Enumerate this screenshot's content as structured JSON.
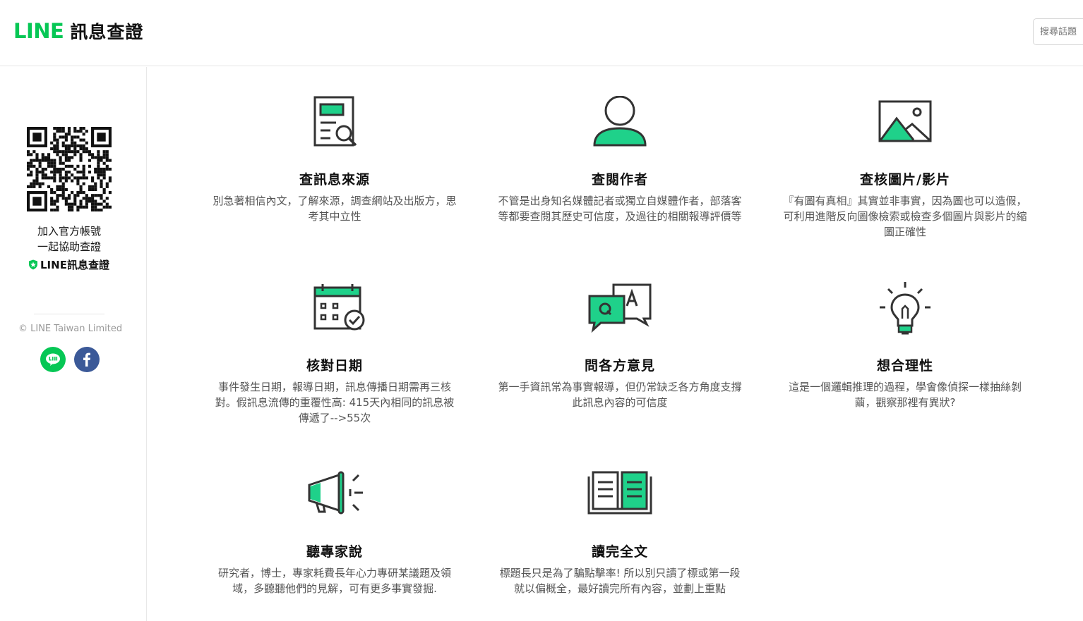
{
  "header": {
    "logo_brand": "LINE",
    "logo_name": "訊息查證",
    "search_placeholder": "搜尋話題"
  },
  "sidebar": {
    "join_line1": "加入官方帳號",
    "join_line2": "一起協助查證",
    "brand_label": "LINE訊息查證",
    "copyright": "© LINE Taiwan Limited",
    "social": [
      "line-icon",
      "facebook-icon"
    ]
  },
  "colors": {
    "accent": "#06c755",
    "icon_green": "#1fd18a",
    "facebook": "#3b5998",
    "text": "#111111"
  },
  "cards": [
    {
      "icon": "document-search-icon",
      "title": "查訊息來源",
      "desc": "別急著相信內文，了解來源，調查網站及出版方，思考其中立性"
    },
    {
      "icon": "person-icon",
      "title": "查閱作者",
      "desc": "不管是出身知名媒體記者或獨立自媒體作者，部落客等都要查閱其歷史可信度，及過往的相關報導評價等"
    },
    {
      "icon": "image-icon",
      "title": "查核圖片/影片",
      "desc": "『有圖有真相』其實並非事實，因為圖也可以造假，可利用進階反向圖像檢索或檢查多個圖片與影片的縮圖正確性"
    },
    {
      "icon": "calendar-check-icon",
      "title": "核對日期",
      "desc": "事件發生日期，報導日期，訊息傳播日期需再三核對。假訊息流傳的重覆性高: 415天內相同的訊息被傳遞了-->55次"
    },
    {
      "icon": "qa-bubbles-icon",
      "title": "問各方意見",
      "desc": "第一手資訊常為事實報導，但仍常缺乏各方角度支撐此訊息內容的可信度"
    },
    {
      "icon": "lightbulb-icon",
      "title": "想合理性",
      "desc": "這是一個邏輯推理的過程，學會像偵探一樣抽絲剝繭，觀察那裡有異狀?"
    },
    {
      "icon": "megaphone-icon",
      "title": "聽專家說",
      "desc": "研究者，博士，專家耗費長年心力專研某議題及領域，多聽聽他們的見解，可有更多事實發掘."
    },
    {
      "icon": "open-book-icon",
      "title": "讀完全文",
      "desc": "標題長只是為了騙點擊率! 所以別只讀了標或第一段就以偏概全，最好讀完所有內容，並劃上重點"
    }
  ]
}
